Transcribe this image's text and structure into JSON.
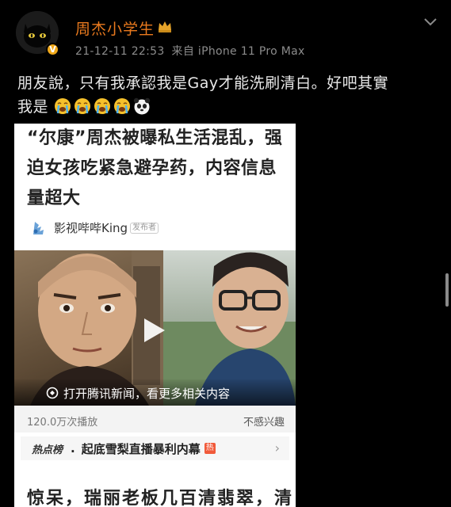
{
  "post": {
    "username": "周杰小学生",
    "date": "21-12-11 22:53",
    "source": "来自 iPhone 11 Pro Max",
    "text_line1": "朋友說，只有我承認我是Gay才能洗刷清白。好吧其實",
    "text_line2": "我是",
    "emojis": [
      "crying-face-emoji",
      "crying-face-emoji",
      "crying-face-emoji",
      "crying-face-emoji",
      "panda-emoji"
    ],
    "verified_badge": "V"
  },
  "card": {
    "headline": "“尔康”周杰被曝私生活混乱，强迫女孩吃紧急避孕药，内容信息量超大",
    "source_name": "影视哔哔King",
    "source_tag": "发布者",
    "video_banner": "打开腾讯新闻，看更多相关内容",
    "views": "120.0万次播放",
    "not_interested": "不感兴趣",
    "hot_label": "热点榜",
    "hot_title": "起底雪梨直播暴利内幕",
    "hot_badge": "热",
    "next_headline": "惊呆，瑞丽老板几百清翡翠，清"
  },
  "colors": {
    "username": "#ea7a1e",
    "badge": "#f1a91a",
    "hot_badge": "#f15a3a"
  }
}
